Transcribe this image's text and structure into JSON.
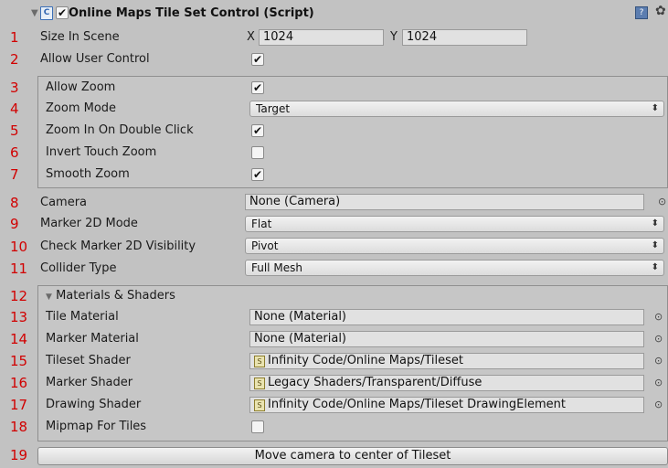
{
  "header": {
    "title": "Online Maps Tile Set Control (Script)",
    "enabled": true
  },
  "row_numbers": [
    "1",
    "2",
    "3",
    "4",
    "5",
    "6",
    "7",
    "8",
    "9",
    "10",
    "11",
    "12",
    "13",
    "14",
    "15",
    "16",
    "17",
    "18",
    "19"
  ],
  "fields": {
    "size_in_scene": {
      "label": "Size In Scene",
      "x_label": "X",
      "x_value": "1024",
      "y_label": "Y",
      "y_value": "1024"
    },
    "allow_user_control": {
      "label": "Allow User Control",
      "checked": true
    },
    "allow_zoom": {
      "label": "Allow Zoom",
      "checked": true
    },
    "zoom_mode": {
      "label": "Zoom Mode",
      "value": "Target"
    },
    "zoom_in_on_double_click": {
      "label": "Zoom In On Double Click",
      "checked": true
    },
    "invert_touch_zoom": {
      "label": "Invert Touch Zoom",
      "checked": false
    },
    "smooth_zoom": {
      "label": "Smooth Zoom",
      "checked": true
    },
    "camera": {
      "label": "Camera",
      "value": "None (Camera)"
    },
    "marker_2d_mode": {
      "label": "Marker 2D Mode",
      "value": "Flat"
    },
    "check_marker_2d_visibility": {
      "label": "Check Marker 2D Visibility",
      "value": "Pivot"
    },
    "collider_type": {
      "label": "Collider Type",
      "value": "Full Mesh"
    },
    "materials_shaders": {
      "label": "Materials & Shaders",
      "expanded": true
    },
    "tile_material": {
      "label": "Tile Material",
      "value": "None (Material)"
    },
    "marker_material": {
      "label": "Marker Material",
      "value": "None (Material)"
    },
    "tileset_shader": {
      "label": "Tileset Shader",
      "value": "Infinity Code/Online Maps/Tileset"
    },
    "marker_shader": {
      "label": "Marker Shader",
      "value": "Legacy Shaders/Transparent/Diffuse"
    },
    "drawing_shader": {
      "label": "Drawing Shader",
      "value": "Infinity Code/Online Maps/Tileset DrawingElement"
    },
    "mipmap_for_tiles": {
      "label": "Mipmap For Tiles",
      "checked": false
    }
  },
  "buttons": {
    "move_camera": "Move camera to center of Tileset"
  },
  "icons": {
    "fold": "fold-arrow-down-icon",
    "script": "script-icon",
    "help": "help-book-icon",
    "settings": "gear-icon",
    "object_picker": "object-picker-circle-icon",
    "shader": "shader-icon"
  },
  "colors": {
    "row_number": "#d10000",
    "background": "#c2c2c2",
    "field_bg": "#e1e1e1"
  }
}
